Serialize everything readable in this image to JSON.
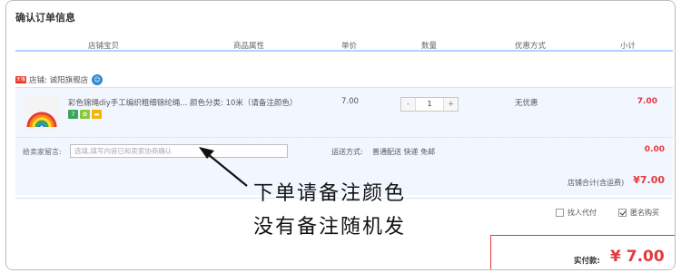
{
  "section_title": "确认订单信息",
  "columns": {
    "shop_item": "店铺宝贝",
    "props": "商品属性",
    "price": "单价",
    "qty": "数量",
    "promo": "优惠方式",
    "subtotal": "小计"
  },
  "shop": {
    "badge": "天猫",
    "name": "店铺: 诚阳旗舰店",
    "chat_icon": "wangwang-icon"
  },
  "item": {
    "title": "彩色锦绳diy手工编织粗细锦纶绳...",
    "props": "颜色分类: 10米（请备注颜色）",
    "price": "7.00",
    "quantity": "1",
    "minus_label": "-",
    "plus_label": "+",
    "promo": "无优惠",
    "subtotal": "7.00",
    "service_icons": [
      {
        "name": "seven-day-return-icon",
        "glyph": "7"
      },
      {
        "name": "guarantee-icon",
        "glyph": "✿"
      },
      {
        "name": "credit-card-icon",
        "glyph": "▬"
      }
    ]
  },
  "message": {
    "label": "给卖家留言:",
    "placeholder": "选填,填写内容已和卖家协商确认"
  },
  "shipping": {
    "label": "运送方式:",
    "value": "普通配送 快递 免邮",
    "fee": "0.00"
  },
  "shop_total": {
    "label": "店铺合计(含运费)",
    "value": "¥7.00"
  },
  "options": {
    "proxy_pay": "找人代付",
    "anonymous": "匿名购买",
    "anonymous_checked": true,
    "proxy_checked": false
  },
  "payment": {
    "label": "实付款:",
    "value": "¥ 7.00"
  },
  "annotation": {
    "line1": "下单请备注颜色",
    "line2": "没有备注随机发"
  },
  "colors": {
    "accent_red": "#e4393c",
    "header_line": "#b2d1ff",
    "row_bg": "#f2f7ff"
  }
}
